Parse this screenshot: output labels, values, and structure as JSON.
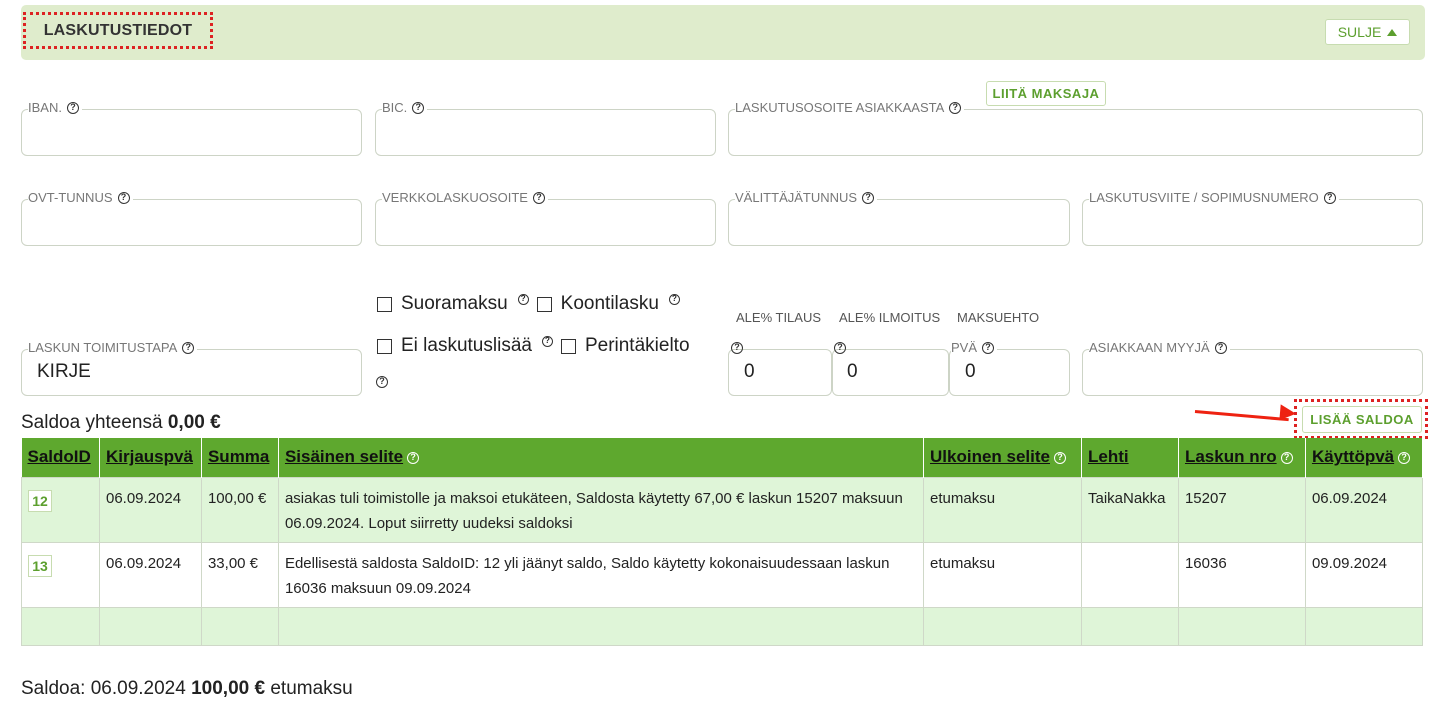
{
  "section": {
    "title": "LASKUTUSTIEDOT",
    "close_label": "SULJE"
  },
  "fields": {
    "iban": {
      "label": "IBAN.",
      "value": ""
    },
    "bic": {
      "label": "BIC.",
      "value": ""
    },
    "billing_address": {
      "label": "LASKUTUSOSOITE ASIAKKAASTA",
      "value": "",
      "attach_payer_label": "LIITÄ MAKSAJA"
    },
    "ovt": {
      "label": "OVT-TUNNUS",
      "value": ""
    },
    "einvoice_address": {
      "label": "VERKKOLASKUOSOITE",
      "value": ""
    },
    "operator_id": {
      "label": "VÄLITTÄJÄTUNNUS",
      "value": ""
    },
    "invoice_reference": {
      "label": "LASKUTUSVIITE / SOPIMUSNUMERO",
      "value": ""
    },
    "delivery_method": {
      "label": "LASKUN TOIMITUSTAPA",
      "value": "KIRJE"
    },
    "discount_order": {
      "caption": "ALE% TILAUS",
      "value": "0"
    },
    "discount_notice": {
      "caption": "ALE% ILMOITUS",
      "value": "0"
    },
    "payment_terms": {
      "caption": "MAKSUEHTO",
      "label": "PVÄ",
      "value": "0"
    },
    "customer_seller": {
      "label": "ASIAKKAAN MYYJÄ",
      "value": ""
    }
  },
  "checkboxes": {
    "direct_payment": {
      "label": "Suoramaksu",
      "checked": false
    },
    "summary_invoice": {
      "label": "Koontilasku",
      "checked": false
    },
    "no_billing_fee": {
      "label": "Ei laskutuslisää",
      "checked": false
    },
    "collection_ban": {
      "label": "Perintäkielto",
      "checked": false
    }
  },
  "saldo": {
    "total_prefix": "Saldoa yhteensä",
    "total_value": "0,00 €",
    "add_label": "LISÄÄ SALDOA",
    "columns": [
      "SaldoID",
      "Kirjauspvä",
      "Summa",
      "Sisäinen selite",
      "Ulkoinen selite",
      "Lehti",
      "Laskun nro",
      "Käyttöpvä"
    ],
    "rows": [
      {
        "id": "12",
        "date": "06.09.2024",
        "amount": "100,00 €",
        "internal": "asiakas tuli toimistolle ja maksoi etukäteen, Saldosta käytetty 67,00 € laskun 15207 maksuun 06.09.2024. Loput siirretty uudeksi saldoksi",
        "external": "etumaksu",
        "paper": "TaikaNakka",
        "invoice_no": "15207",
        "use_date": "06.09.2024"
      },
      {
        "id": "13",
        "date": "06.09.2024",
        "amount": "33,00 €",
        "internal": "Edellisestä saldosta SaldoID: 12 yli jäänyt saldo, Saldo käytetty kokonaisuudessaan laskun 16036 maksuun 09.09.2024",
        "external": "etumaksu",
        "paper": "",
        "invoice_no": "16036",
        "use_date": "09.09.2024"
      }
    ],
    "footer_prefix": "Saldoa: 06.09.2024",
    "footer_amount": "100,00 €",
    "footer_suffix": "etumaksu"
  }
}
